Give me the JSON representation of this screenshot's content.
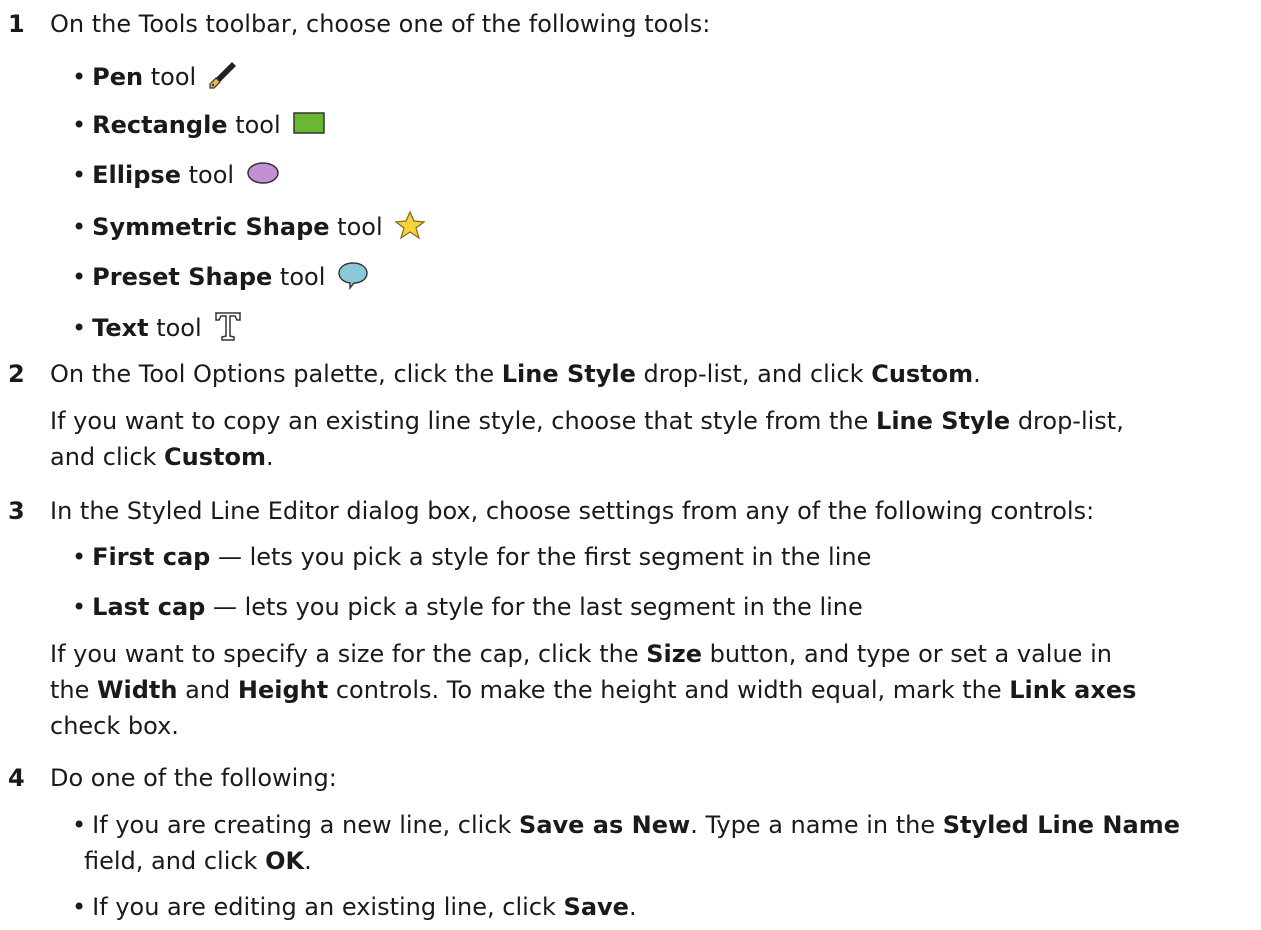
{
  "step1": {
    "num": "1",
    "text": "On the Tools toolbar, choose one of the following tools:",
    "tools": [
      {
        "name": "Pen",
        "suffix": " tool",
        "icon": "pen-icon"
      },
      {
        "name": "Rectangle",
        "suffix": " tool",
        "icon": "rectangle-icon"
      },
      {
        "name": "Ellipse",
        "suffix": " tool",
        "icon": "ellipse-icon"
      },
      {
        "name": "Symmetric Shape",
        "suffix": " tool",
        "icon": "star-icon"
      },
      {
        "name": "Preset Shape",
        "suffix": " tool",
        "icon": "speech-bubble-icon"
      },
      {
        "name": "Text",
        "suffix": " tool",
        "icon": "text-icon"
      }
    ]
  },
  "step2": {
    "num": "2",
    "t1": "On the Tool Options palette, click the ",
    "b1": "Line Style",
    "t2": " drop-list, and click ",
    "b2": "Custom",
    "t3": ".",
    "p1": "If you want to copy an existing line style, choose that style from the ",
    "p1b": "Line Style",
    "p1c": " drop-list,",
    "p2": "and click ",
    "p2b": "Custom",
    "p2c": "."
  },
  "step3": {
    "num": "3",
    "text": "In the Styled Line Editor dialog box, choose settings from any of the following controls:",
    "b1": "First cap",
    "t1": " — lets you pick a style for the first segment in the line",
    "b2": "Last cap",
    "t2": " — lets you pick a style for the last segment in the line",
    "l1a": "If you want to specify a size for the cap, click the ",
    "l1b": "Size",
    "l1c": " button, and type or set a value in",
    "l2a": "the ",
    "l2b": "Width",
    "l2c": " and ",
    "l2d": "Height",
    "l2e": " controls. To make the height and width equal, mark the ",
    "l2f": "Link axes",
    "l3": "check box."
  },
  "step4": {
    "num": "4",
    "text": "Do one of the following:",
    "a1": "If you are creating a new line, click ",
    "a1b": "Save as New",
    "a1c": ". Type a name in the ",
    "a1d": "Styled Line Name",
    "a2": "field, and click ",
    "a2b": "OK",
    "a2c": ".",
    "b1": "If you are editing an existing line, click ",
    "b1b": "Save",
    "b1c": "."
  },
  "bullet": "•",
  "colors": {
    "rectangle": "#6ab832",
    "ellipse": "#c58fd4",
    "star": "#f7d23e",
    "bubble": "#8cc8dc"
  }
}
